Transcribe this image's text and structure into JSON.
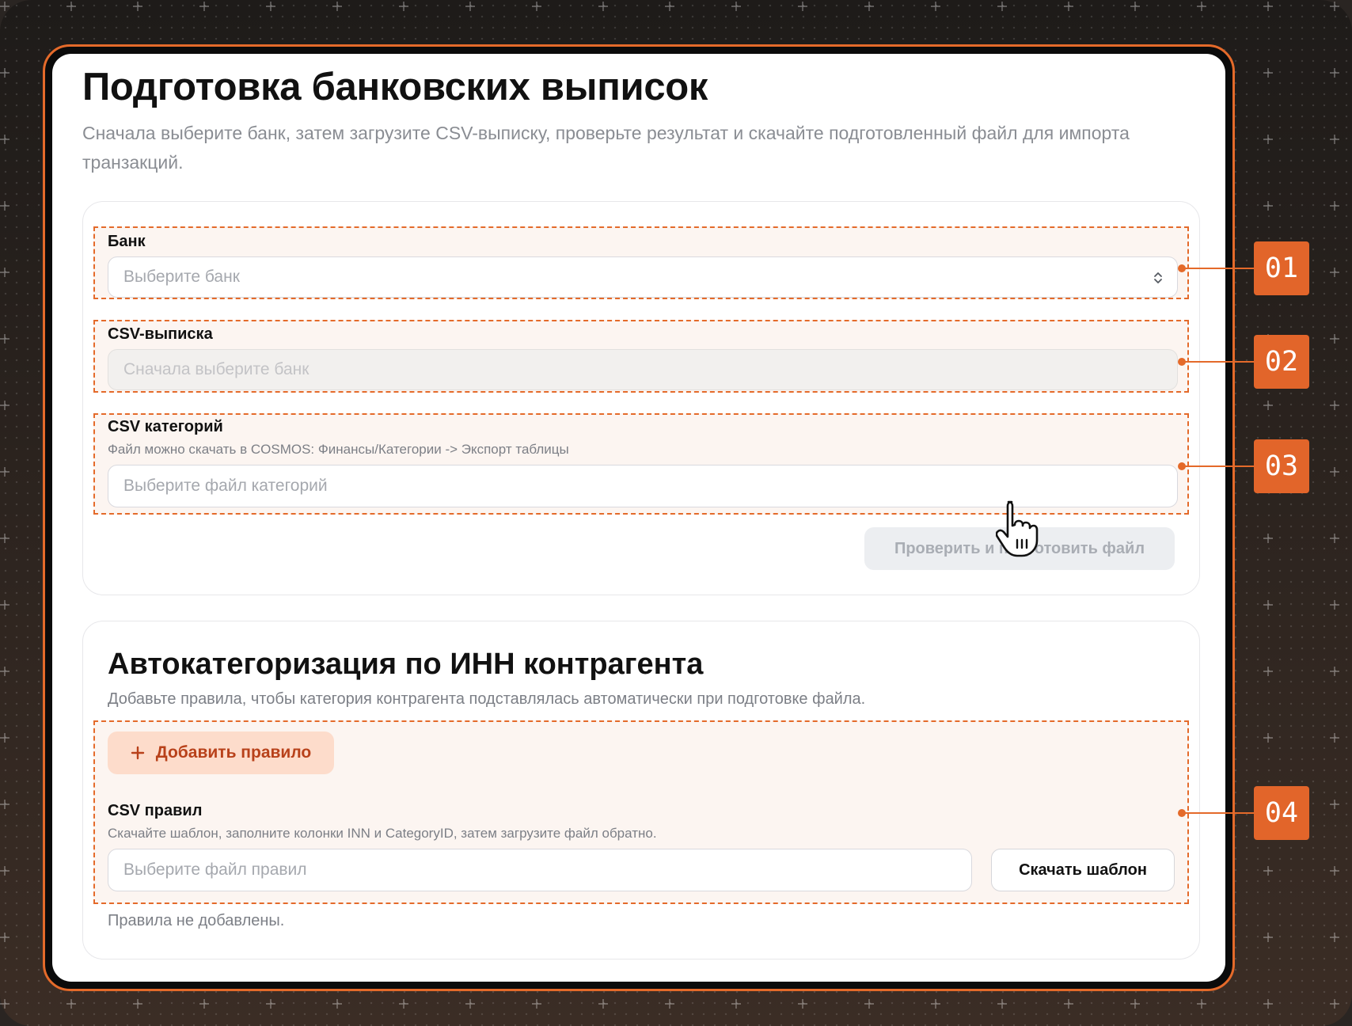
{
  "page": {
    "title": "Подготовка банковских выписок",
    "subtitle": "Сначала выберите банк, затем загрузите CSV-выписку, проверьте результат и скачайте подготовленный файл для импорта транзакций."
  },
  "upload_form": {
    "bank": {
      "label": "Банк",
      "placeholder": "Выберите банк"
    },
    "statement": {
      "label": "CSV-выписка",
      "placeholder": "Сначала выберите банк",
      "disabled": true
    },
    "categories": {
      "label": "CSV категорий",
      "hint": "Файл можно скачать в COSMOS: Финансы/Категории -> Экспорт таблицы",
      "placeholder": "Выберите файл категорий"
    },
    "submit_label": "Проверить и подготовить файл",
    "submit_disabled": true
  },
  "autocategorization": {
    "title": "Автокатегоризация по ИНН контрагента",
    "subtitle": "Добавьте правила, чтобы категория контрагента подставлялась автоматически при подготовке файла.",
    "add_rule_label": "Добавить правило",
    "rules_csv": {
      "label": "CSV правил",
      "hint": "Скачайте шаблон, заполните колонки INN и CategoryID, затем загрузите файл обратно.",
      "placeholder": "Выберите файл правил",
      "download_label": "Скачать шаблон"
    },
    "empty_text": "Правила не добавлены."
  },
  "badges": [
    "01",
    "02",
    "03",
    "04"
  ],
  "colors": {
    "accent": "#e46a2a",
    "zone_fill": "#fcf5f1",
    "add_button_fill": "#fddccb",
    "add_button_text": "#b8411a"
  },
  "icons": {
    "select_chevron": "chevron-up-down-icon",
    "add": "plus-icon",
    "cursor": "hand-pointer-icon"
  }
}
